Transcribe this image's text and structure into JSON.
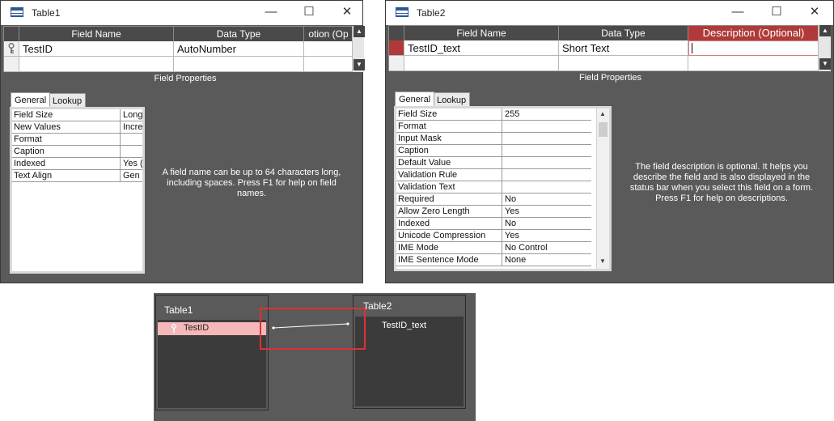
{
  "table1_window": {
    "title": "Table1",
    "columns": [
      "Field Name",
      "Data Type",
      "otion (Op"
    ],
    "rows": [
      {
        "field_name": "TestID",
        "data_type": "AutoNumber",
        "description": ""
      }
    ],
    "field_properties_label": "Field Properties",
    "tabs": [
      "General",
      "Lookup"
    ],
    "properties": [
      {
        "name": "Field Size",
        "value": "Long"
      },
      {
        "name": "New Values",
        "value": "Incre"
      },
      {
        "name": "Format",
        "value": ""
      },
      {
        "name": "Caption",
        "value": ""
      },
      {
        "name": "Indexed",
        "value": "Yes ("
      },
      {
        "name": "Text Align",
        "value": "Gen"
      }
    ],
    "help_text": "A field name can be up to 64 characters long, including spaces. Press F1 for help on field names."
  },
  "table2_window": {
    "title": "Table2",
    "columns": [
      "Field Name",
      "Data Type",
      "Description (Optional)"
    ],
    "rows": [
      {
        "field_name": "TestID_text",
        "data_type": "Short Text",
        "description": ""
      }
    ],
    "field_properties_label": "Field Properties",
    "tabs": [
      "General",
      "Lookup"
    ],
    "properties": [
      {
        "name": "Field Size",
        "value": "255"
      },
      {
        "name": "Format",
        "value": ""
      },
      {
        "name": "Input Mask",
        "value": ""
      },
      {
        "name": "Caption",
        "value": ""
      },
      {
        "name": "Default Value",
        "value": ""
      },
      {
        "name": "Validation Rule",
        "value": ""
      },
      {
        "name": "Validation Text",
        "value": ""
      },
      {
        "name": "Required",
        "value": "No"
      },
      {
        "name": "Allow Zero Length",
        "value": "Yes"
      },
      {
        "name": "Indexed",
        "value": "No"
      },
      {
        "name": "Unicode Compression",
        "value": "Yes"
      },
      {
        "name": "IME Mode",
        "value": "No Control"
      },
      {
        "name": "IME Sentence Mode",
        "value": "None"
      }
    ],
    "help_text": "The field description is optional. It helps you describe the field and is also displayed in the status bar when you select this field on a form. Press F1 for help on descriptions."
  },
  "window_controls": {
    "minimize": "—",
    "maximize": "☐",
    "close": "✕"
  },
  "relationships": {
    "table1": {
      "name": "Table1",
      "fields": [
        "TestID"
      ]
    },
    "table2": {
      "name": "Table2",
      "fields": [
        "TestID_text"
      ]
    }
  },
  "colors": {
    "dark_bg": "#5a5a5a",
    "header_bg": "#4a4a4a",
    "active_header": "#b03a3a",
    "selected_field": "#f5b8b8",
    "highlight_box": "#e03030"
  }
}
